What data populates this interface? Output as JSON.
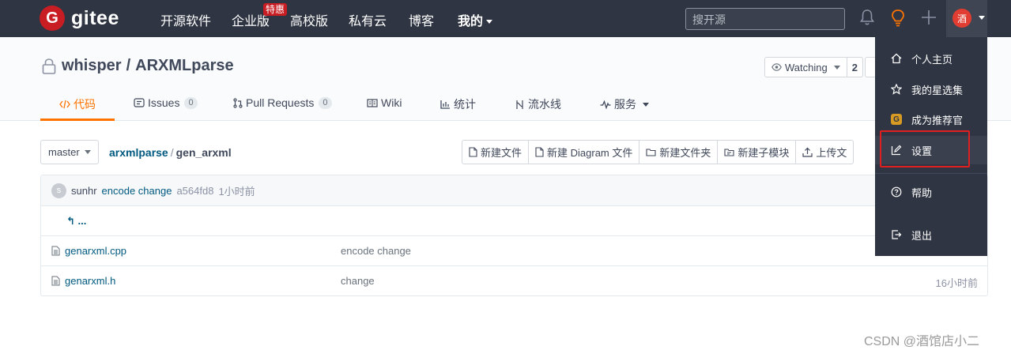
{
  "topnav": {
    "logo_text": "gitee",
    "logo_letter": "G",
    "items": [
      "开源软件",
      "企业版",
      "高校版",
      "私有云",
      "博客",
      "我的"
    ],
    "badge": "特惠",
    "search_placeholder": "搜开源",
    "avatar_text": "酒"
  },
  "repo": {
    "owner": "whisper",
    "name": "ARXMLparse",
    "separator": "/",
    "watch_label": "Watching",
    "watch_count": "2"
  },
  "tabs": [
    {
      "label": "代码",
      "icon": "code-icon"
    },
    {
      "label": "Issues",
      "count": "0",
      "icon": "issues-icon"
    },
    {
      "label": "Pull Requests",
      "count": "0",
      "icon": "pull-request-icon"
    },
    {
      "label": "Wiki",
      "icon": "wiki-icon"
    },
    {
      "label": "统计",
      "icon": "stats-icon"
    },
    {
      "label": "流水线",
      "icon": "pipeline-icon"
    },
    {
      "label": "服务",
      "icon": "service-icon"
    }
  ],
  "toolbar": {
    "branch": "master",
    "path_root": "arxmlparse",
    "path_sep": "/",
    "path_current": "gen_arxml",
    "buttons": [
      "新建文件",
      "新建 Diagram 文件",
      "新建文件夹",
      "新建子模块",
      "上传文"
    ]
  },
  "commit": {
    "avatar_letter": "s",
    "user": "sunhr",
    "message": "encode change",
    "hash": "a564fd8",
    "time": "1小时前"
  },
  "files": {
    "up_label": "...",
    "rows": [
      {
        "name": "genarxml.cpp",
        "message": "encode change",
        "time": ""
      },
      {
        "name": "genarxml.h",
        "message": "change",
        "time": "16小时前"
      }
    ]
  },
  "dropdown": {
    "items": [
      {
        "label": "个人主页",
        "icon": "home-icon"
      },
      {
        "label": "我的星选集",
        "icon": "star-icon"
      },
      {
        "label": "成为推荐官",
        "icon": "badge-icon",
        "badge": "G"
      },
      {
        "label": "设置",
        "icon": "edit-icon"
      },
      {
        "label": "帮助",
        "icon": "help-icon"
      },
      {
        "label": "退出",
        "icon": "logout-icon"
      }
    ],
    "highlight_color": "#e02020"
  },
  "watermark": "CSDN @酒馆店小二",
  "colors": {
    "nav_bg": "#2f3542",
    "brand": "#c71d23",
    "accent": "#fe7300",
    "link": "#005980"
  }
}
